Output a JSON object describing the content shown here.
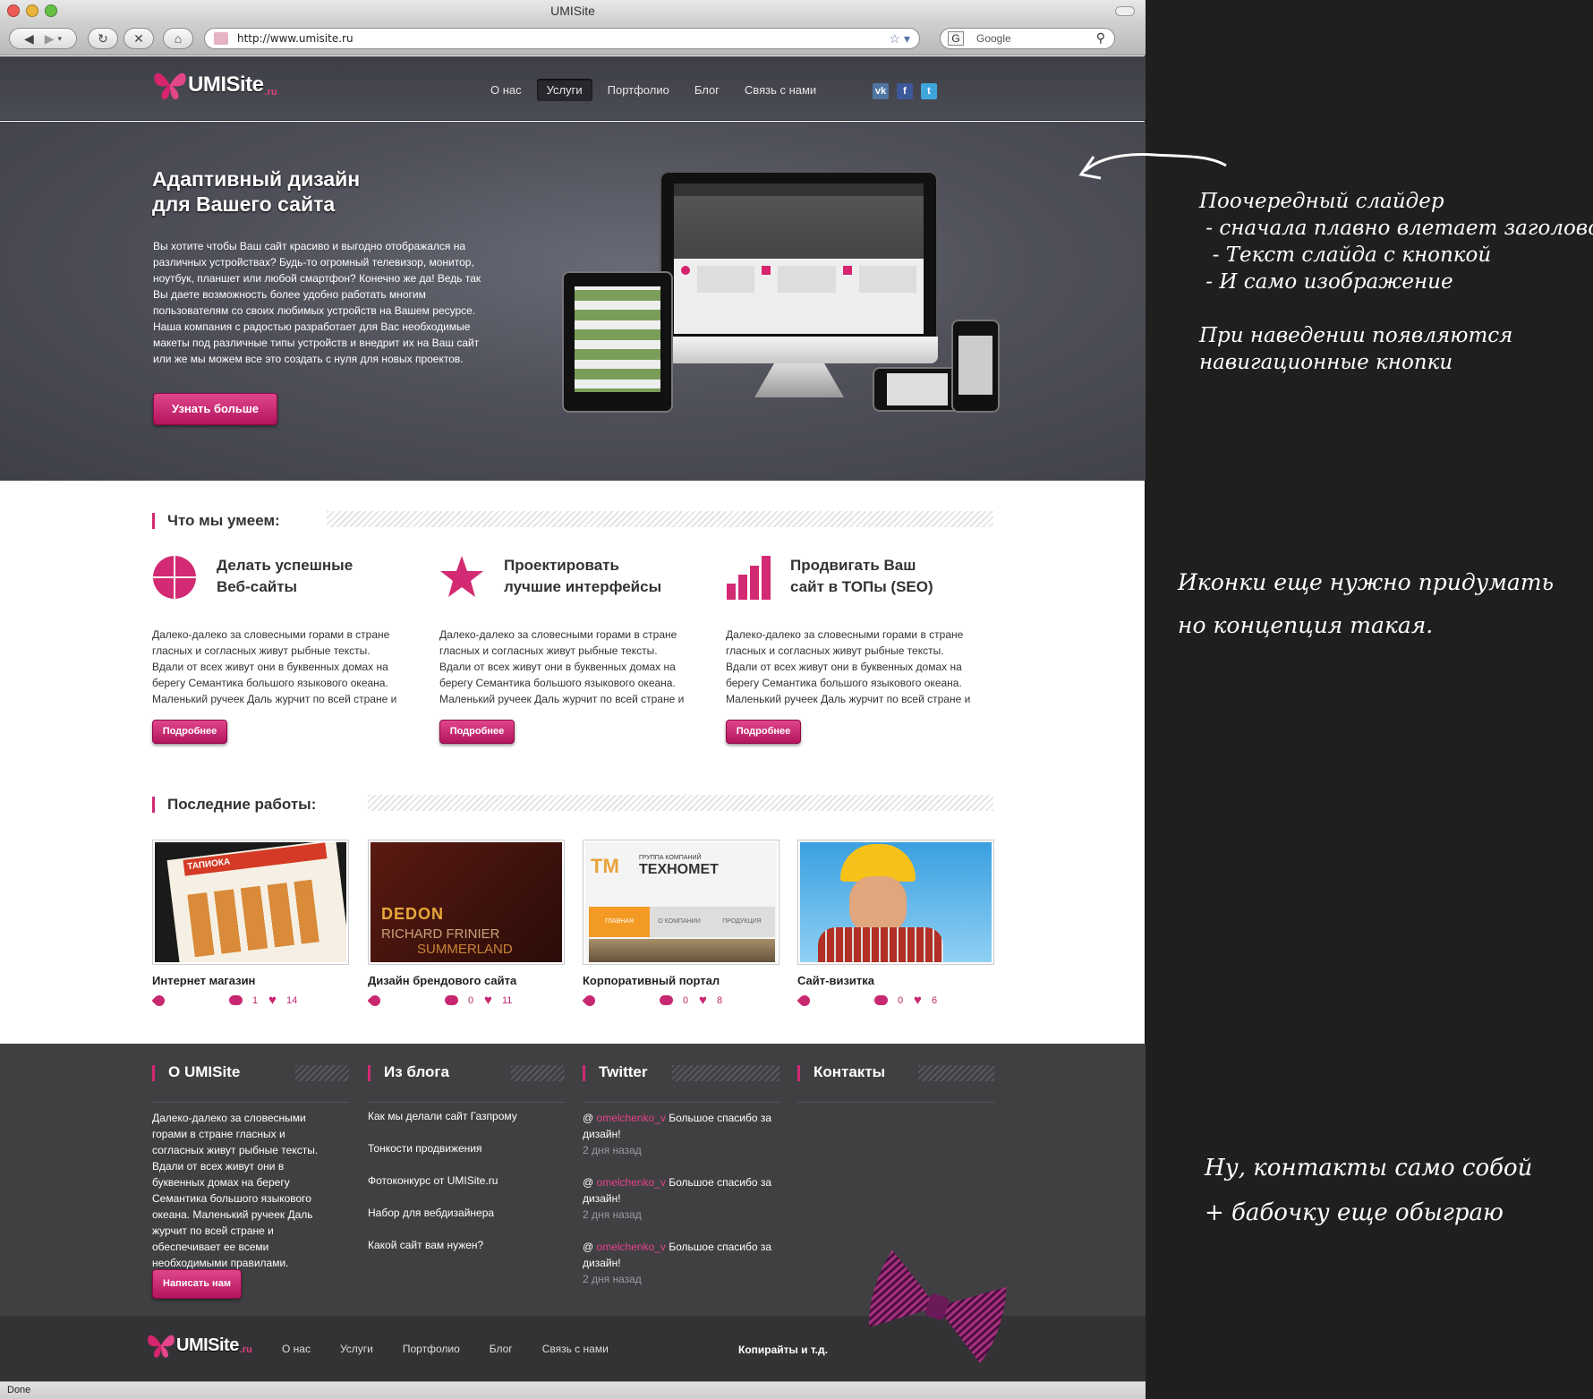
{
  "window": {
    "title": "UMISite",
    "status": "Done"
  },
  "toolbar": {
    "url": "http://www.umisite.ru",
    "search_placeholder": "Google"
  },
  "site": {
    "logo": {
      "name": "UMISite",
      "tld": ".ru"
    },
    "nav": [
      {
        "label": "О нас"
      },
      {
        "label": "Услуги",
        "active": true
      },
      {
        "label": "Портфолио"
      },
      {
        "label": "Блог"
      },
      {
        "label": "Связь с нами"
      }
    ],
    "socials": [
      "vk-icon",
      "facebook-icon",
      "twitter-icon"
    ]
  },
  "hero": {
    "title_line1": "Адаптивный дизайн",
    "title_line2": "для Вашего сайта",
    "text": "Вы хотите чтобы Ваш сайт красиво и выгодно отображался на различных устройствах? Будь-то огромный телевизор, монитор, ноутбук, планшет или любой смартфон? Конечно же да! Ведь так Вы даете возможность более удобно работать многим пользователям со своих любимых устройств на Вашем ресурсе. Наша компания с радостью разработает для Вас необходимые макеты под различные типы устройств и внедрит их на Ваш сайт или же мы можем все это создать с нуля для новых проектов.",
    "button": "Узнать больше"
  },
  "skills": {
    "title": "Что мы умеем:",
    "items": [
      {
        "title_line1": "Делать успешные",
        "title_line2": "Веб-сайты",
        "icon": "globe-icon",
        "text": "Далеко-далеко за словесными горами в стране гласных и согласных живут рыбные тексты. Вдали от всех живут они в буквенных домах на берегу Семантика большого языкового океана. Маленький ручеек Даль журчит по всей стране и",
        "button": "Подробнее"
      },
      {
        "title_line1": "Проектировать",
        "title_line2": "лучшие интерфейсы",
        "icon": "star-icon",
        "text": "Далеко-далеко за словесными горами в стране гласных и согласных живут рыбные тексты. Вдали от всех живут они в буквенных домах на берегу Семантика большого языкового океана. Маленький ручеек Даль журчит по всей стране и",
        "button": "Подробнее"
      },
      {
        "title_line1": "Продвигать Ваш",
        "title_line2": "сайт в ТОПы (SEO)",
        "icon": "bar-chart-icon",
        "text": "Далеко-далеко за словесными горами в стране гласных и согласных живут рыбные тексты. Вдали от всех живут они в буквенных домах на берегу Семантика большого языкового океана. Маленький ручеек Даль журчит по всей стране и",
        "button": "Подробнее"
      }
    ]
  },
  "works": {
    "title": "Последние работы:",
    "items": [
      {
        "title": "Интернет магазин",
        "comments": "1",
        "likes": "14",
        "thumb_text": "ТАПИОКА"
      },
      {
        "title": "Дизайн брендового сайта",
        "comments": "0",
        "likes": "11",
        "thumb_line1": "DEDON",
        "thumb_line2": "RICHARD FRINIER",
        "thumb_line3": "SUMMERLAND"
      },
      {
        "title": "Корпоративный портал",
        "comments": "0",
        "likes": "8",
        "thumb_small": "ГРУППА КОМПАНИЙ",
        "thumb_brand": "ТЕХНОМЕТ",
        "thumb_tab1": "ГЛАВНАЯ",
        "thumb_tab2": "О КОМПАНИИ",
        "thumb_tab3": "ПРОДУКЦИЯ"
      },
      {
        "title": "Сайт-визитка",
        "comments": "0",
        "likes": "6"
      }
    ]
  },
  "footer": {
    "about": {
      "title": "О UMISite",
      "text": "Далеко-далеко за словесными горами в стране гласных и согласных живут рыбные тексты. Вдали от всех живут они в буквенных домах на берегу Семантика большого языкового океана. Маленький ручеек Даль журчит по всей стране и обеспечивает ее всеми необходимыми правилами.",
      "button": "Написать нам"
    },
    "blog": {
      "title": "Из блога",
      "links": [
        "Как мы делали сайт Газпрому",
        "Тонкости продвижения",
        "Фотоконкурс от UMISite.ru",
        "Набор для вебдизайнера",
        "Какой сайт вам нужен?"
      ]
    },
    "twitter": {
      "title": "Twitter",
      "tweets": [
        {
          "at": "@",
          "user": "omelchenko_v",
          "text": "Большое спасибо за дизайн!",
          "date": "2 дня назад"
        },
        {
          "at": "@",
          "user": "omelchenko_v",
          "text": "Большое спасибо за дизайн!",
          "date": "2 дня назад"
        },
        {
          "at": "@",
          "user": "omelchenko_v",
          "text": "Большое спасибо за дизайн!",
          "date": "2 дня назад"
        }
      ]
    },
    "contacts": {
      "title": "Контакты"
    },
    "bottom_nav": [
      "О нас",
      "Услуги",
      "Портфолио",
      "Блог",
      "Связь с нами"
    ],
    "copyright": "Копирайты и т.д."
  },
  "notes": {
    "slider": "Поочередный слайдер\n - сначала плавно влетает заголовок\n  - Текст слайда с кнопкой\n - И само изображение\n\nПри наведении появляются\nнавигационные кнопки",
    "icons": "Иконки еще нужно придумать\nно концепция такая.",
    "contacts": "Ну, контакты само собой\n+ бабочку еще обыграю"
  },
  "colors": {
    "accent": "#c8286f",
    "header": "#44454d",
    "footer": "#404043"
  }
}
